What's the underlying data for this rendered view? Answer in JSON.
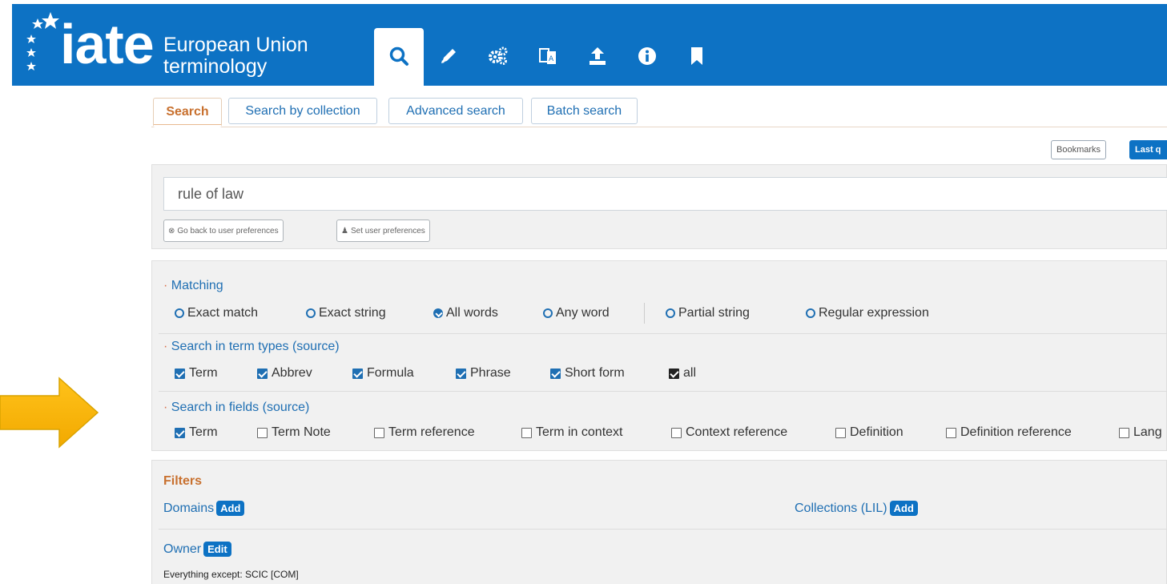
{
  "header": {
    "logo_text": "iate",
    "logo_sub_line1": "European Union",
    "logo_sub_line2": "terminology",
    "nav_icons": [
      "search-icon",
      "pencil-icon",
      "gears-icon",
      "translate-icon",
      "upload-icon",
      "info-icon",
      "bookmark-icon"
    ],
    "color": "#0d72c4"
  },
  "tabs": [
    {
      "label": "Search",
      "active": true
    },
    {
      "label": "Search by collection",
      "active": false
    },
    {
      "label": "Advanced search",
      "active": false
    },
    {
      "label": "Batch search",
      "active": false
    }
  ],
  "top_buttons": {
    "bookmarks": "Bookmarks",
    "last_queries": "Last q"
  },
  "search": {
    "query": "rule of law",
    "go_back_pref": "Go back to user preferences",
    "set_pref": "Set user preferences"
  },
  "matching": {
    "label": "Matching",
    "options": [
      {
        "label": "Exact match",
        "checked": false
      },
      {
        "label": "Exact string",
        "checked": false
      },
      {
        "label": "All words",
        "checked": true
      },
      {
        "label": "Any word",
        "checked": false
      },
      {
        "label": "Partial string",
        "checked": false
      },
      {
        "label": "Regular expression",
        "checked": false
      }
    ]
  },
  "term_types": {
    "label": "Search in term types (source)",
    "options": [
      {
        "label": "Term",
        "checked": true
      },
      {
        "label": "Abbrev",
        "checked": true
      },
      {
        "label": "Formula",
        "checked": true
      },
      {
        "label": "Phrase",
        "checked": true
      },
      {
        "label": "Short form",
        "checked": true
      },
      {
        "label": "all",
        "checked": true
      }
    ]
  },
  "fields": {
    "label": "Search in fields (source)",
    "options": [
      {
        "label": "Term",
        "checked": true
      },
      {
        "label": "Term Note",
        "checked": false
      },
      {
        "label": "Term reference",
        "checked": false
      },
      {
        "label": "Term in context",
        "checked": false
      },
      {
        "label": "Context reference",
        "checked": false
      },
      {
        "label": "Definition",
        "checked": false
      },
      {
        "label": "Definition reference",
        "checked": false
      },
      {
        "label": "Lang",
        "checked": false
      }
    ]
  },
  "filters": {
    "title": "Filters",
    "domains": "Domains",
    "domains_btn": "Add",
    "collections": "Collections (LIL)",
    "collections_btn": "Add",
    "owner": "Owner",
    "owner_btn": "Edit",
    "owner_value": "Everything except: SCIC [COM]"
  },
  "arrow_color": "#f6b400"
}
